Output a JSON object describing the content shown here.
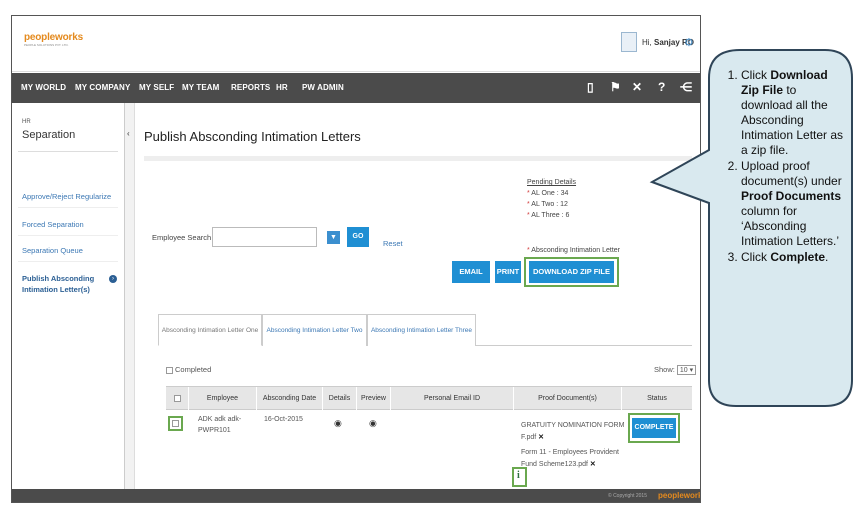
{
  "header": {
    "logo_main": "peopleworks",
    "logo_tag": "PEOPLE SOLUTIONS PVT. LTD.",
    "greeting_prefix": "Hi, ",
    "user_name": "Sanjay RO"
  },
  "nav": {
    "items": [
      "MY WORLD",
      "MY COMPANY",
      "MY SELF",
      "MY TEAM",
      "REPORTS",
      "HR",
      "PW ADMIN"
    ]
  },
  "sidebar": {
    "section_small": "HR",
    "section_title": "Separation",
    "links": [
      "Approve/Reject Regularize",
      "Forced Separation",
      "Separation Queue",
      "Publish Absconding Intimation Letter(s)"
    ]
  },
  "main": {
    "title": "Publish Absconding Intimation Letters",
    "pending": {
      "heading": "Pending Details",
      "items": [
        "AL One : 34",
        "AL Two : 12",
        "AL Three : 6"
      ],
      "note": "Absconding Intimation Letter"
    },
    "search": {
      "label": "Employee Search",
      "go": "GO",
      "reset": "Reset"
    },
    "buttons": {
      "email": "EMAIL",
      "print": "PRINT",
      "download_zip": "DOWNLOAD ZIP FILE"
    },
    "tabs": [
      "Absconding Intimation Letter One",
      "Absconding Intimation Letter Two",
      "Absconding Intimation Letter Three"
    ],
    "completed_label": "Completed",
    "show_label": "Show:",
    "show_value": "10",
    "table": {
      "headers": [
        "",
        "Employee",
        "Absconding Date",
        "Details",
        "Preview",
        "Personal Email ID",
        "Proof Document(s)",
        "Status"
      ],
      "row": {
        "employee_line1": "ADK adk adk-",
        "employee_line2": "PWPR101",
        "date": "16-Oct-2015",
        "doc1_line1": "GRATUITY NOMINATION FORM",
        "doc1_line2": "F.pdf",
        "doc2_line1": "Form 11 - Employees Provident",
        "doc2_line2": "Fund Scheme123.pdf",
        "status_button": "COMPLETE"
      }
    }
  },
  "footer": {
    "copyright": "© Copyright 2015",
    "brand": "peopleworks"
  },
  "callout": {
    "step1_pre": "Click ",
    "step1_bold": "Download Zip File",
    "step1_post": " to download all the Absconding Intimation Letter as a zip file.",
    "step2_pre": "Upload proof document(s) under ",
    "step2_bold": "Proof Documents",
    "step2_post": " column for ‘Absconding Intimation Letters.’",
    "step3_pre": "Click ",
    "step3_bold": "Complete",
    "step3_post": "."
  }
}
